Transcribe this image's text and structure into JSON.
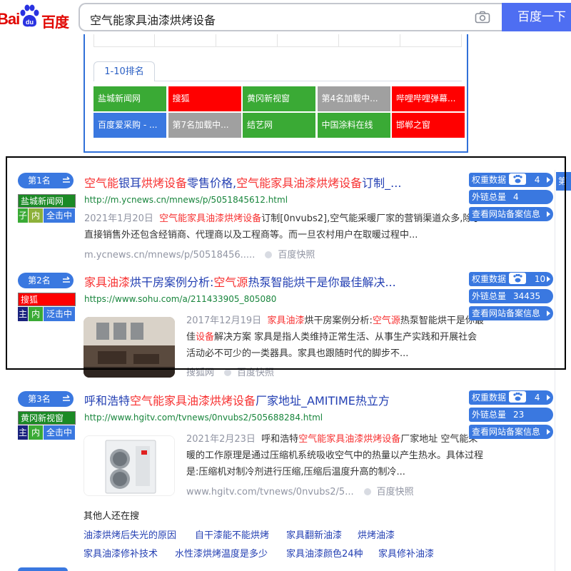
{
  "header": {
    "logo_text_left": "Bai",
    "logo_text_right": "百度",
    "query": "空气能家具油漆烘烤设备",
    "search_button": "百度一下"
  },
  "ranking": {
    "tab_label": "1-10排名",
    "cells": [
      {
        "label": "盐城新闻网",
        "color": "#3aaa35"
      },
      {
        "label": "搜狐",
        "color": "#ff0000"
      },
      {
        "label": "黄冈新视窗",
        "color": "#3aaa35"
      },
      {
        "label": "第4名加载中...",
        "color": "#a0a0a0"
      },
      {
        "label": "哔哩哔哩弹幕...",
        "color": "#ff0000"
      },
      {
        "label": "百度爱采购 - ...",
        "color": "#3a78e0"
      },
      {
        "label": "第7名加载中...",
        "color": "#a0a0a0"
      },
      {
        "label": "结艺网",
        "color": "#3aaa35"
      },
      {
        "label": "中国涂料在线",
        "color": "#3aaa35"
      },
      {
        "label": "邯郸之窗",
        "color": "#ff0000"
      }
    ]
  },
  "results": [
    {
      "rank": "第1名",
      "site_name": "盐城新闻网",
      "site_color": "#1b8a25",
      "tags": [
        "子",
        "内",
        "全击中"
      ],
      "tag_colors": [
        "#3aaa35",
        "#8db13a"
      ],
      "title_parts": [
        {
          "t": "空气能",
          "hl": true
        },
        {
          "t": "银耳",
          "hl": false
        },
        {
          "t": "烘烤设备",
          "hl": true
        },
        {
          "t": "零售价格,",
          "hl": false
        },
        {
          "t": "空气能家具油漆烘烤设备",
          "hl": true
        },
        {
          "t": "订制_...",
          "hl": false
        }
      ],
      "url": "http://m.ycnews.cn/mnews/p/5051845612.html",
      "date": "2021年1月20日",
      "abstract_parts": [
        {
          "t": "空气能家具油漆烘烤设备",
          "hl": true
        },
        {
          "t": "订制[0nvubs2],空气能采暖厂家的营销渠道众多,除了直接销售外还包含经销商、代理商以及工程商等。而一旦农村用户在取暖过程中...",
          "hl": false
        }
      ],
      "foot_source": "m.ycnews.cn/mnews/p/50518456.....",
      "foot_snapshot": "百度快照",
      "weight_label": "权重数据",
      "weight_value": "4",
      "links_label": "外链总量",
      "links_value": "4",
      "icp_label": "查看网站备案信息"
    },
    {
      "rank": "第2名",
      "site_name": "搜狐",
      "site_color": "#ff0000",
      "tags": [
        "主",
        "内",
        "泛击中"
      ],
      "tag_colors": [
        "#1a237e",
        "#3aaa35"
      ],
      "title_parts": [
        {
          "t": "家具油漆",
          "hl": true
        },
        {
          "t": "烘干房案例分析:",
          "hl": false
        },
        {
          "t": "空气源",
          "hl": true
        },
        {
          "t": "热泵智能烘干是你最佳解决...",
          "hl": false
        }
      ],
      "url": "https://www.sohu.com/a/211433905_805080",
      "date": "2017年12月19日",
      "abstract_parts": [
        {
          "t": "家具油漆",
          "hl": true
        },
        {
          "t": "烘干房案例分析:",
          "hl": false
        },
        {
          "t": "空气源",
          "hl": true
        },
        {
          "t": "热泵智能烘干是你最佳",
          "hl": false
        },
        {
          "t": "设备",
          "hl": true
        },
        {
          "t": "解决方案 家具是指人类维持正常生活、从事生产实践和开展社会活动必不可少的一类器具。家具也跟随时代的脚步不...",
          "hl": false
        }
      ],
      "foot_source": "搜狐网",
      "foot_snapshot": "百度快照",
      "weight_label": "权重数据",
      "weight_value": "10",
      "links_label": "外链总量",
      "links_value": "34435",
      "icp_label": "查看网站备案信息"
    },
    {
      "rank": "第3名",
      "site_name": "黄冈新视窗",
      "site_color": "#1b8a25",
      "tags": [
        "主",
        "内",
        "全击中"
      ],
      "tag_colors": [
        "#1a237e",
        "#3aaa35"
      ],
      "title_parts": [
        {
          "t": "呼和浩特",
          "hl": false
        },
        {
          "t": "空气能家具油漆烘烤设备",
          "hl": true
        },
        {
          "t": "厂家地址_AMITIME热立方",
          "hl": false
        }
      ],
      "url": "http://www.hgitv.com/tvnews/0nvubs2/505688284.html",
      "date": "2021年2月23日",
      "abstract_parts": [
        {
          "t": "呼和浩特",
          "hl": false
        },
        {
          "t": "空气能家具油漆烘烤设备",
          "hl": true
        },
        {
          "t": "厂家地址 空气能采暖的工作原理是通过压缩机系统吸收空气中的热量以产生热水。具体过程是:压缩机对制冷剂进行压缩,压缩后温度升高的制冷...",
          "hl": false
        }
      ],
      "foot_source": "www.hgitv.com/tvnews/0nvubs2/5...",
      "foot_snapshot": "百度快照",
      "weight_label": "权重数据",
      "weight_value": "4",
      "links_label": "外链总量",
      "links_value": "23",
      "icp_label": "查看网站备案信息"
    }
  ],
  "related": {
    "title": "其他人还在搜",
    "links": [
      "油漆烘烤后失光的原因",
      "自干漆能不能烘烤",
      "家具翻新油漆",
      "烘烤油漆",
      "家具油漆修补技术",
      "水性漆烘烤温度是多少",
      "家具油漆颜色24种",
      "家具修补油漆"
    ]
  },
  "right_tab": "第"
}
